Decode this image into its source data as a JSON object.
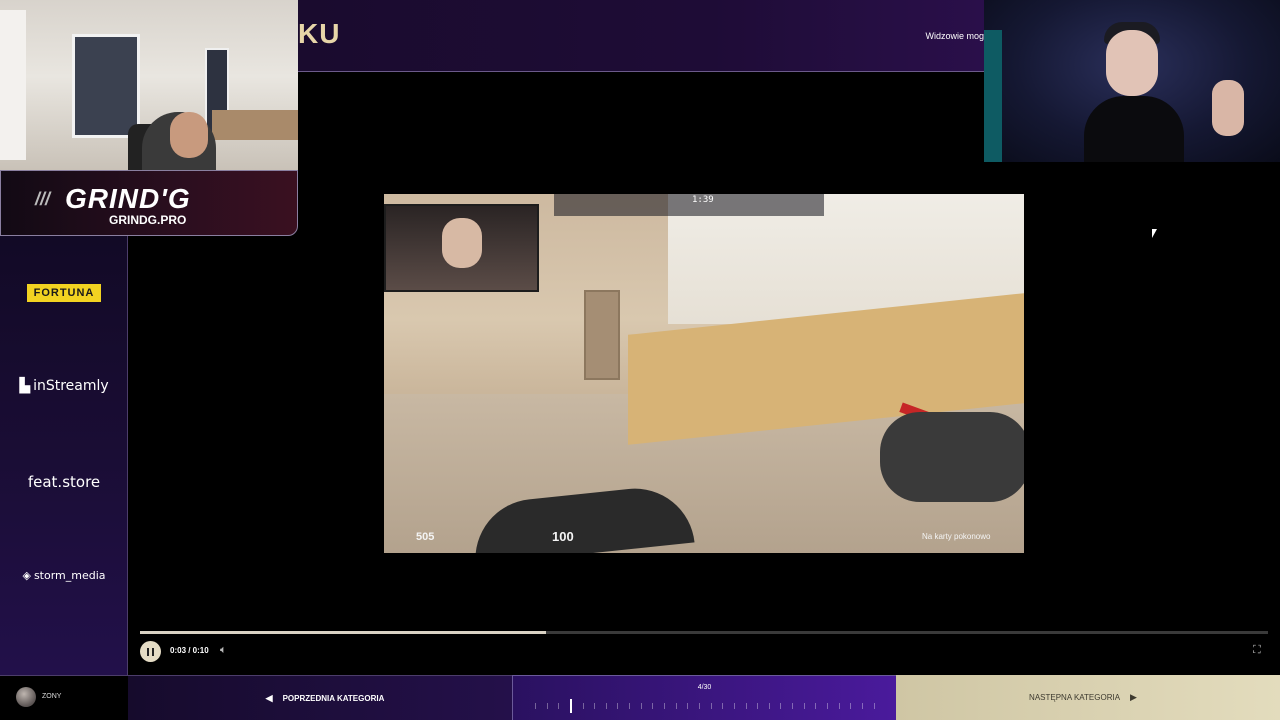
{
  "header": {
    "title_fragment": "KU",
    "note": "Widzowie mog"
  },
  "branding": {
    "logo_text": "GRIND'G",
    "logo_site": "GRINDG.PRO"
  },
  "sponsors": [
    {
      "name": "FORTUNA"
    },
    {
      "name": "inStreamly"
    },
    {
      "name": "feat.store"
    },
    {
      "name": "storm_media"
    }
  ],
  "video": {
    "hud_time": "1:39",
    "health": "505",
    "armor": "100",
    "note": "Na karty pokonowo"
  },
  "player": {
    "time": "0:03 / 0:10",
    "progress": 0.36
  },
  "bottom": {
    "user_name": "ZONY",
    "prev_label": "POPRZEDNIA KATEGORIA",
    "counter": "4/30",
    "next_label": "NASTĘPNA KATEGORIA",
    "active_tick": 4,
    "total_ticks": 30
  },
  "icons": {
    "play": "pause-icon",
    "volume": "volume-icon",
    "fullscreen": "fullscreen-icon",
    "prev": "arrow-left-icon",
    "next": "arrow-right-icon"
  },
  "colors": {
    "accent_gold": "#e7d6a8",
    "fortuna_yellow": "#f2d321",
    "purple": "#2a1160"
  }
}
